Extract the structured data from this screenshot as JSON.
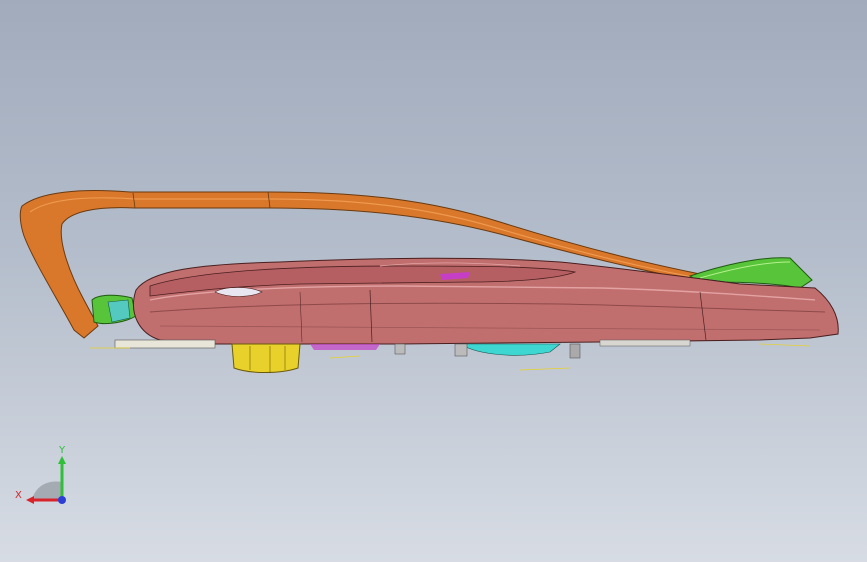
{
  "viewport": {
    "title": "",
    "background_top": "#a1abbc",
    "background_bottom": "#d7dce4"
  },
  "model": {
    "parts": [
      {
        "name": "orange-frame-rail",
        "color": "#d9772a"
      },
      {
        "name": "main-panel-body",
        "color": "#c16e6e"
      },
      {
        "name": "green-end-cap",
        "color": "#58c43a"
      },
      {
        "name": "yellow-bracket",
        "color": "#e8d12a"
      },
      {
        "name": "blue-insert",
        "color": "#3f7fd0"
      },
      {
        "name": "cyan-component",
        "color": "#3ed6d0"
      },
      {
        "name": "magenta-detail",
        "color": "#c63ec6"
      }
    ]
  },
  "triad": {
    "x_label": "X",
    "y_label": "Y",
    "x_color": "#d9232a",
    "y_color": "#2fbf3a",
    "z_color": "#2b3fd6"
  }
}
